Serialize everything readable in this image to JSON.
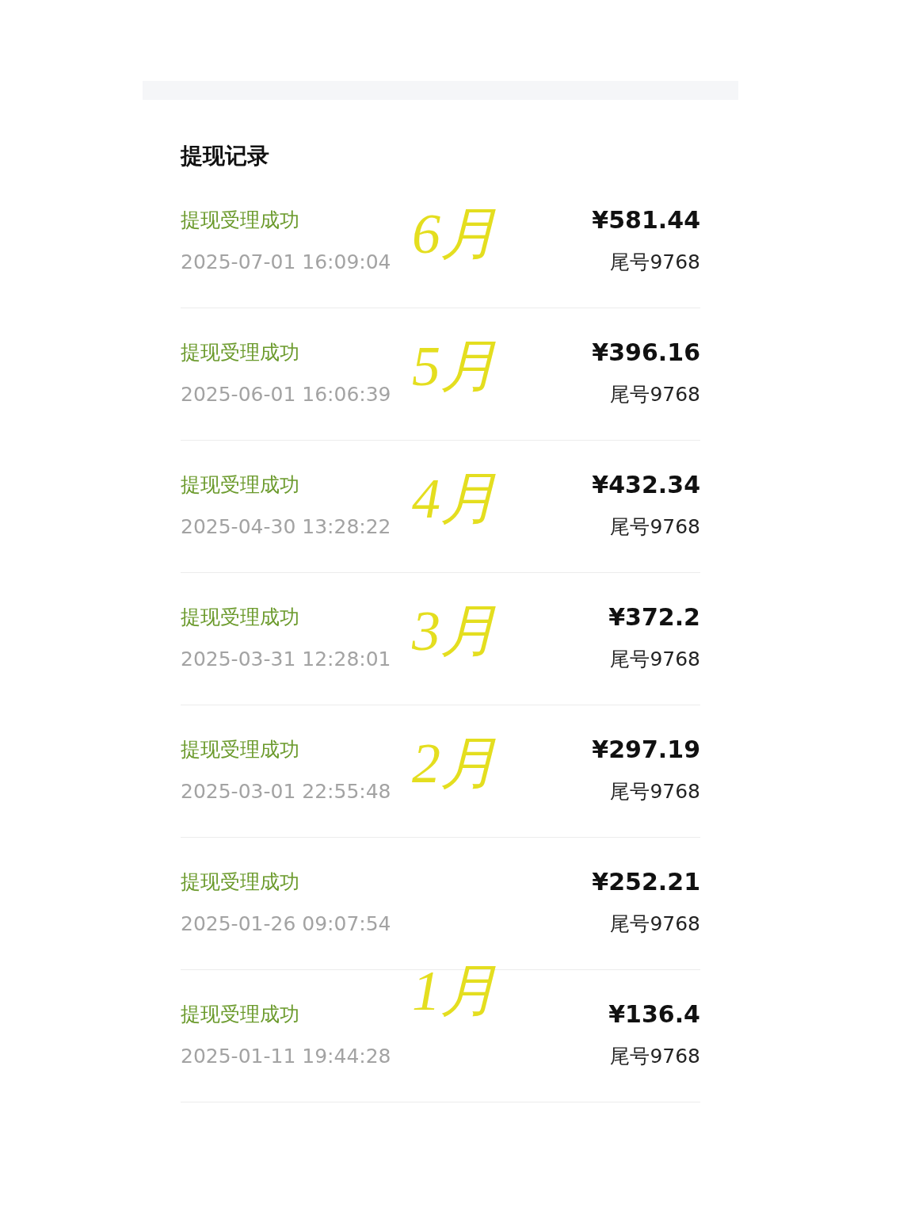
{
  "title": "提现记录",
  "records": [
    {
      "status": "提现受理成功",
      "time": "2025-07-01 16:09:04",
      "amount": "¥581.44",
      "card": "尾号9768",
      "annotation": {
        "text": "6月",
        "kind": "inline"
      }
    },
    {
      "status": "提现受理成功",
      "time": "2025-06-01 16:06:39",
      "amount": "¥396.16",
      "card": "尾号9768",
      "annotation": {
        "text": "5月",
        "kind": "inline"
      }
    },
    {
      "status": "提现受理成功",
      "time": "2025-04-30 13:28:22",
      "amount": "¥432.34",
      "card": "尾号9768",
      "annotation": {
        "text": "4月",
        "kind": "inline"
      }
    },
    {
      "status": "提现受理成功",
      "time": "2025-03-31 12:28:01",
      "amount": "¥372.2",
      "card": "尾号9768",
      "annotation": {
        "text": "3月",
        "kind": "inline"
      }
    },
    {
      "status": "提现受理成功",
      "time": "2025-03-01 22:55:48",
      "amount": "¥297.19",
      "card": "尾号9768",
      "annotation": {
        "text": "2月",
        "kind": "inline"
      }
    },
    {
      "status": "提现受理成功",
      "time": "2025-01-26 09:07:54",
      "amount": "¥252.21",
      "card": "尾号9768"
    },
    {
      "status": "提现受理成功",
      "time": "2025-01-11 19:44:28",
      "amount": "¥136.4",
      "card": "尾号9768",
      "annotation": {
        "text": "1月",
        "kind": "straddling"
      }
    }
  ]
}
